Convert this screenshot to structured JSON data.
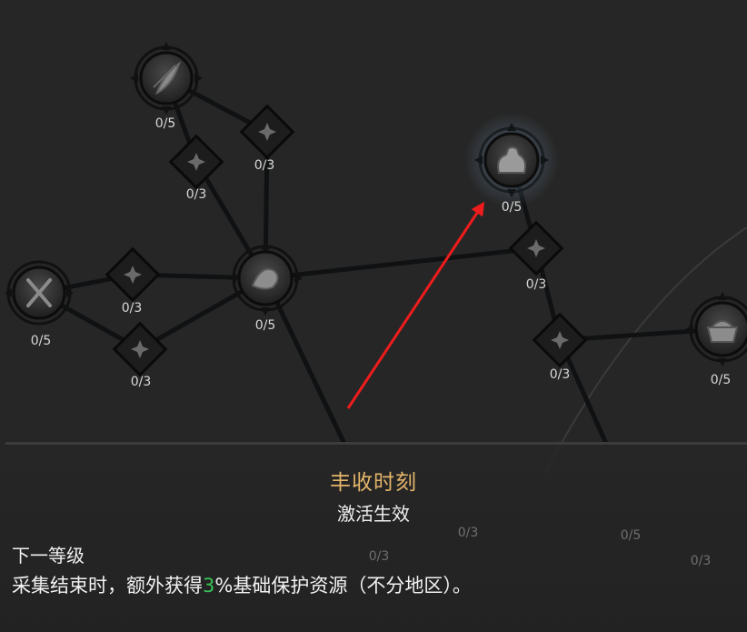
{
  "colors": {
    "background": "#262626",
    "title": "#e4b56a",
    "highlight": "#38c455",
    "arrow": "#ee1c1c"
  },
  "nodes": [
    {
      "id": "crossed-tools",
      "kind": "major",
      "icon": "crossed-tools-icon",
      "label": "0/5"
    },
    {
      "id": "feather-wing",
      "kind": "major",
      "icon": "feather-icon",
      "label": "0/5"
    },
    {
      "id": "ore-hand",
      "kind": "major",
      "icon": "ore-hand-icon",
      "label": "0/5"
    },
    {
      "id": "harvest-sack",
      "kind": "major",
      "icon": "sack-icon",
      "label": "0/5",
      "selected": true
    },
    {
      "id": "basket-right",
      "kind": "major",
      "icon": "basket-icon",
      "label": "0/5"
    },
    {
      "id": "d-top-left",
      "kind": "minor",
      "icon": "diamond-icon",
      "label": "0/3"
    },
    {
      "id": "d-top-right",
      "kind": "minor",
      "icon": "diamond-icon",
      "label": "0/3"
    },
    {
      "id": "d-mid-top",
      "kind": "minor",
      "icon": "diamond-icon",
      "label": "0/3"
    },
    {
      "id": "d-mid-bottom",
      "kind": "minor",
      "icon": "diamond-icon",
      "label": "0/3"
    },
    {
      "id": "d-right-top",
      "kind": "minor",
      "icon": "diamond-icon",
      "label": "0/3"
    },
    {
      "id": "d-right-bottom",
      "kind": "minor",
      "icon": "diamond-icon",
      "label": "0/3"
    },
    {
      "id": "faded-1",
      "kind": "faded",
      "label": "0/3"
    },
    {
      "id": "faded-2",
      "kind": "faded",
      "label": "0/3"
    },
    {
      "id": "faded-3",
      "kind": "faded",
      "label": "0/5"
    },
    {
      "id": "faded-4",
      "kind": "faded",
      "label": "0/3"
    }
  ],
  "panel": {
    "title": "丰收时刻",
    "status": "激活生效",
    "next_level_label": "下一等级",
    "description_prefix": "采集结束时，额外获得",
    "description_value": "3",
    "description_suffix": "%基础保护资源（不分地区）。"
  }
}
